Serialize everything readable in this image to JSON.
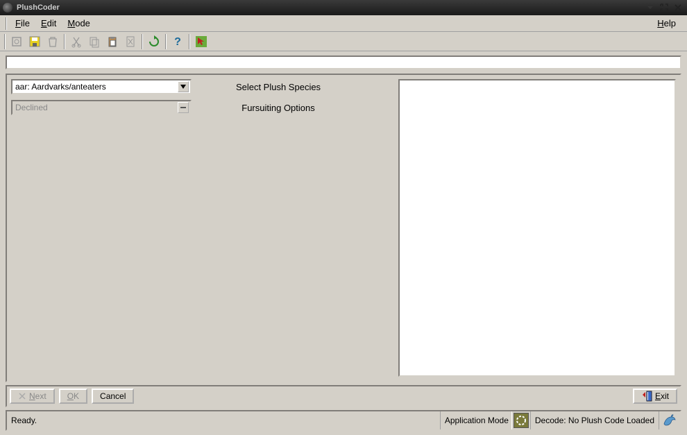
{
  "window": {
    "title": "PlushCoder"
  },
  "menu": {
    "file": "File",
    "edit": "Edit",
    "mode": "Mode",
    "help": "Help"
  },
  "form": {
    "species_value": "aar: Aardvarks/anteaters",
    "species_label": "Select Plush Species",
    "fursuiting_value": "Declined",
    "fursuiting_label": "Fursuiting Options"
  },
  "buttons": {
    "next": "Next",
    "ok": "OK",
    "cancel": "Cancel",
    "exit": "Exit"
  },
  "status": {
    "ready": "Ready.",
    "mode_label": "Application Mode",
    "decode": "Decode: No Plush Code Loaded"
  }
}
